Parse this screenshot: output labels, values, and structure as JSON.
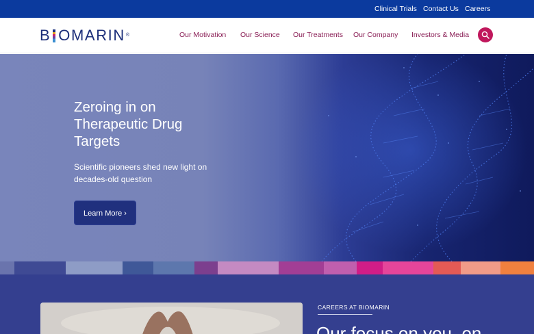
{
  "utility_nav": [
    {
      "label": "Clinical Trials"
    },
    {
      "label": "Contact Us"
    },
    {
      "label": "Careers"
    }
  ],
  "logo": {
    "text_before": "B",
    "text_after": "OMARIN",
    "registered": "®"
  },
  "main_nav": [
    {
      "label": "Our Motivation"
    },
    {
      "label": "Our Science"
    },
    {
      "label": "Our Treatments"
    },
    {
      "label": "Our Company"
    },
    {
      "label": "Investors & Media"
    }
  ],
  "search": {
    "icon": "search-icon"
  },
  "hero": {
    "title": "Zeroing in on Therapeutic Drug Targets",
    "subtitle": "Scientific pioneers shed new light on decades-old question",
    "button_label": "Learn More ›"
  },
  "color_strip": [
    "#6a74ad",
    "#3f4a94",
    "#8e9cc6",
    "#3f5898",
    "#5d77ad",
    "#7c3f8e",
    "#c48ac2",
    "#a23e95",
    "#c05fae",
    "#d01d87",
    "#e6459a",
    "#e45a55",
    "#f19b88",
    "#f0803e"
  ],
  "careers": {
    "label": "CAREERS AT BIOMARIN",
    "heading": "Our focus on you, on"
  },
  "colors": {
    "utility_bar": "#0b3a9e",
    "nav_text": "#8a1f56",
    "accent": "#c0175c",
    "lower_bg": "#343f8f"
  }
}
